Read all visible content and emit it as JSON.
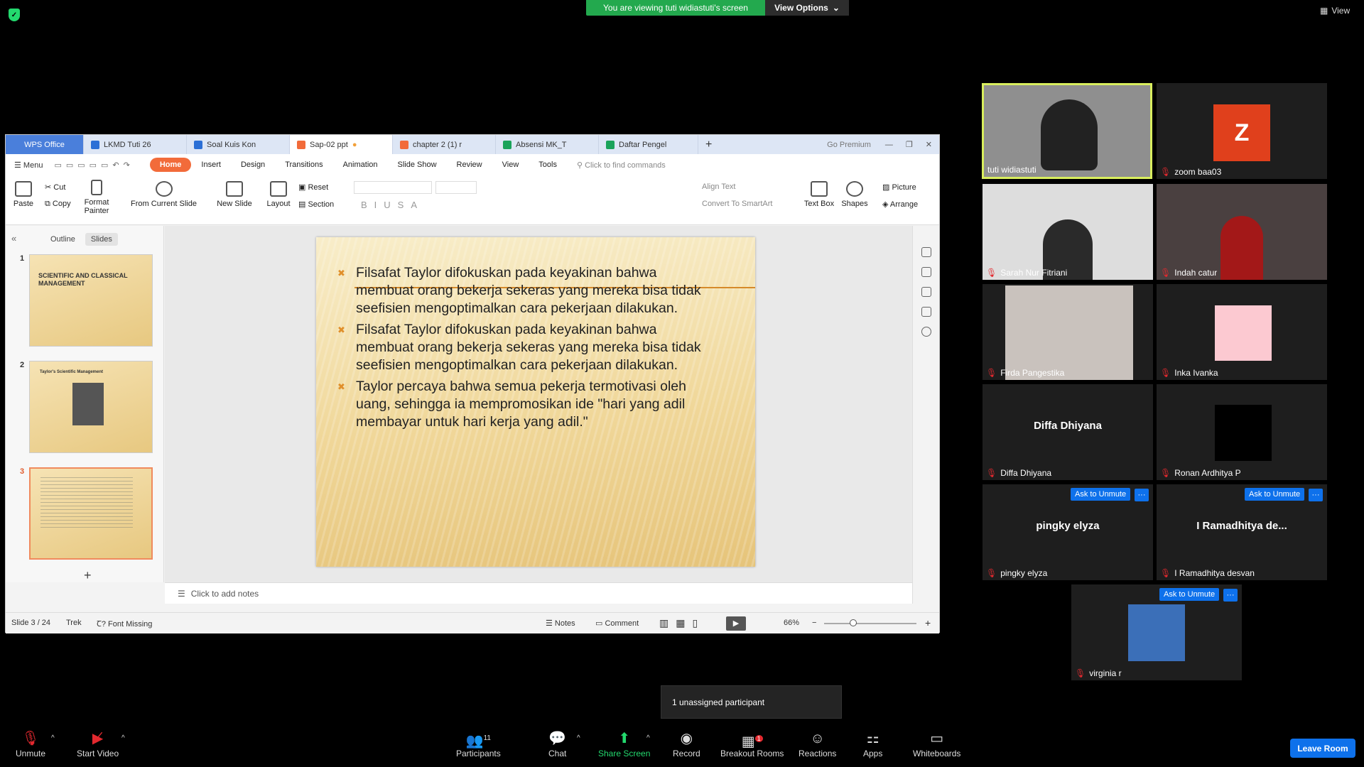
{
  "zoom": {
    "viewing_banner": "You are viewing tuti widiastuti's screen",
    "view_options": "View Options",
    "view_label": "View",
    "unassigned_tooltip": "1 unassigned participant",
    "leave_room": "Leave Room",
    "toolbar": {
      "unmute": "Unmute",
      "start_video": "Start Video",
      "participants": "Participants",
      "participants_count": "11",
      "chat": "Chat",
      "share_screen": "Share Screen",
      "record": "Record",
      "breakout_rooms": "Breakout Rooms",
      "breakout_badge": "1",
      "reactions": "Reactions",
      "apps": "Apps",
      "whiteboards": "Whiteboards"
    },
    "participants": [
      {
        "name": "tuti widiastuti",
        "active": true
      },
      {
        "name": "zoom baa03",
        "avatar_letter": "Z",
        "avatar_color": "#e0401c"
      },
      {
        "name": "Sarah Nur Fitriani"
      },
      {
        "name": "Indah catur"
      },
      {
        "name": "Firda Pangestika"
      },
      {
        "name": "Inka Ivanka"
      },
      {
        "name": "Diffa Dhiyana",
        "display_name": "Diffa Dhiyana"
      },
      {
        "name": "Ronan Ardhitya P"
      },
      {
        "name": "pingky elyza",
        "display_name": "pingky elyza"
      },
      {
        "name": "I Ramadhitya desvan",
        "display_name": "I Ramadhitya de..."
      },
      {
        "name": "virginia r"
      }
    ],
    "ask_to_unmute": "Ask to Unmute",
    "more": "···"
  },
  "wps": {
    "tabs": [
      "WPS Office",
      "LKMD Tuti 26",
      "Soal Kuis Kon",
      "Sap-02 ppt",
      "chapter 2 (1) r",
      "Absensi MK_T",
      "Daftar Pengel"
    ],
    "go_premium": "Go Premium",
    "menu": "Menu",
    "ribbon_tabs": [
      "Home",
      "Insert",
      "Design",
      "Transitions",
      "Animation",
      "Slide Show",
      "Review",
      "View",
      "Tools"
    ],
    "search_commands": "Click to find commands",
    "ribbon": {
      "paste": "Paste",
      "cut": "Cut",
      "copy": "Copy",
      "format_painter": "Format Painter",
      "from_current_slide": "From Current Slide",
      "new_slide": "New Slide",
      "layout": "Layout",
      "reset": "Reset",
      "section": "Section",
      "align_text": "Align Text",
      "convert_smartart": "Convert To SmartArt",
      "text_box": "Text Box",
      "shapes": "Shapes",
      "picture": "Picture",
      "arrange": "Arrange"
    },
    "panel_tabs": [
      "Outline",
      "Slides"
    ],
    "thumbnails": [
      {
        "num": "1",
        "title": "SCIENTIFIC AND CLASSICAL MANAGEMENT"
      },
      {
        "num": "2",
        "title": "Taylor's Scientific Management"
      },
      {
        "num": "3",
        "title": ""
      }
    ],
    "slide_bullets": [
      "Filsafat Taylor difokuskan pada keyakinan bahwa membuat orang bekerja sekeras yang mereka bisa tidak seefisien mengoptimalkan cara pekerjaan dilakukan.",
      "Filsafat Taylor difokuskan pada keyakinan bahwa membuat orang bekerja sekeras yang mereka bisa tidak seefisien mengoptimalkan cara pekerjaan dilakukan.",
      "Taylor percaya bahwa semua pekerja termotivasi oleh uang, sehingga ia mempromosikan ide \"hari yang adil membayar untuk hari kerja yang adil.\""
    ],
    "notes_placeholder": "Click to add notes",
    "status": {
      "slide": "Slide 3 / 24",
      "theme": "Trek",
      "font_missing": "Font Missing",
      "notes": "Notes",
      "comment": "Comment",
      "zoom": "66%"
    }
  }
}
